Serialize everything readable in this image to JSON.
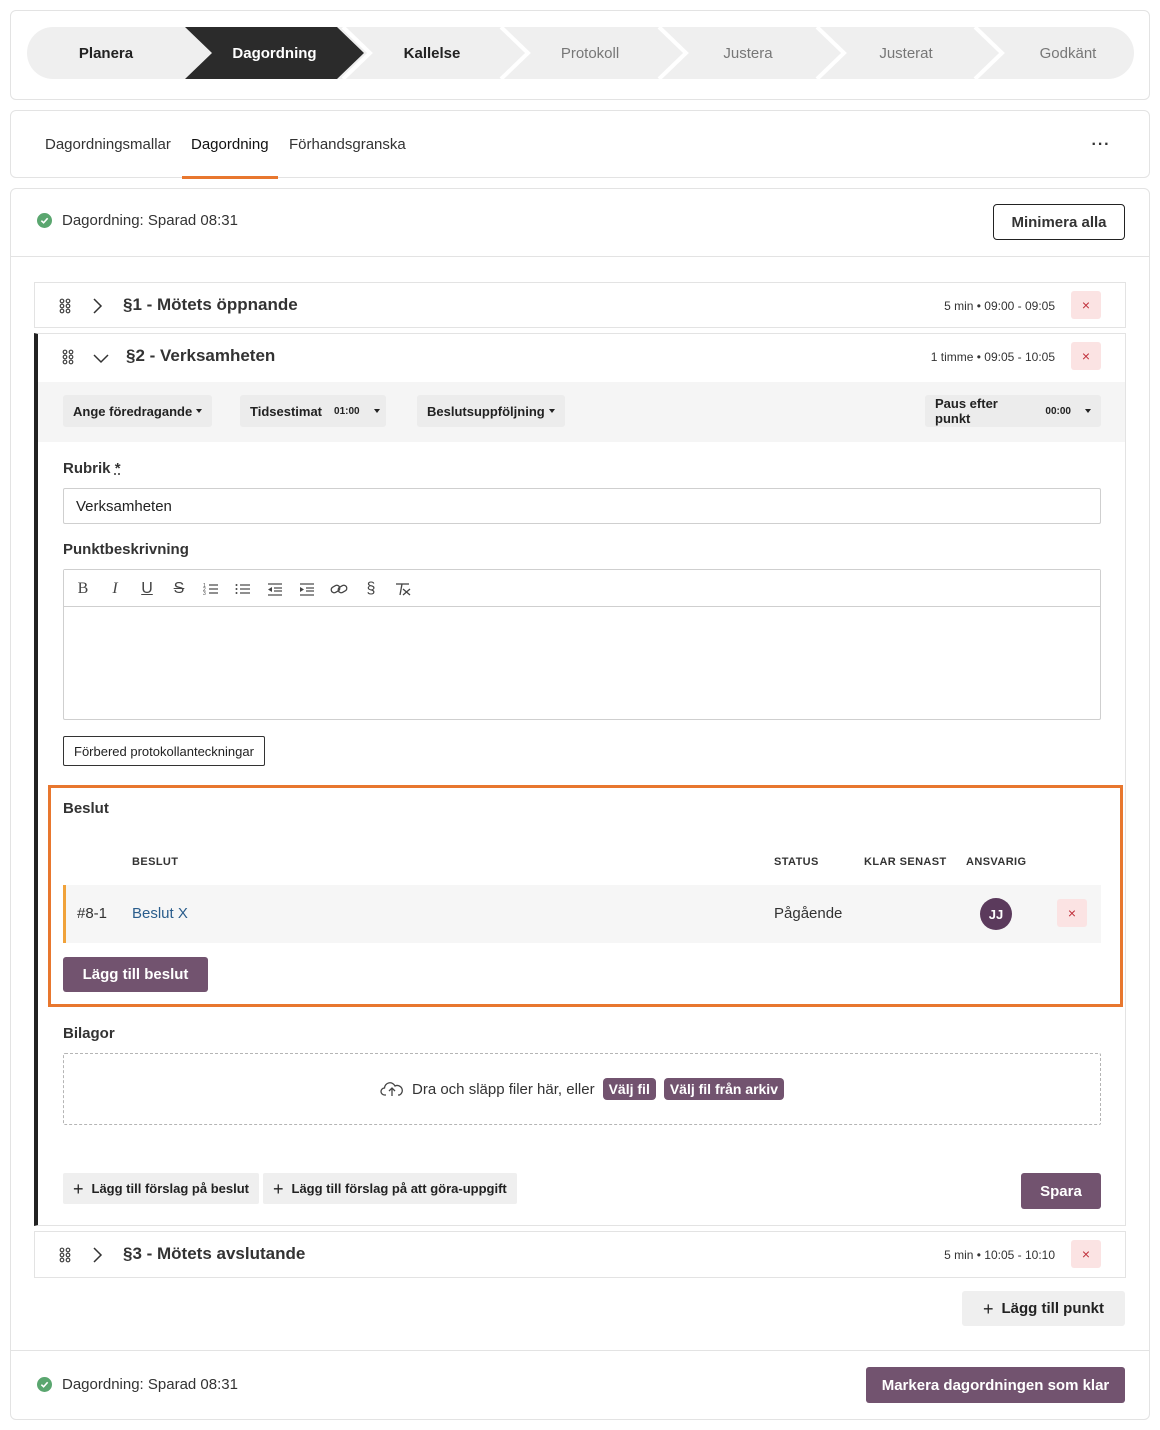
{
  "stepper": {
    "steps": [
      {
        "label": "Planera",
        "state": "done"
      },
      {
        "label": "Dagordning",
        "state": "active"
      },
      {
        "label": "Kallelse",
        "state": "done"
      },
      {
        "label": "Protokoll",
        "state": "future"
      },
      {
        "label": "Justera",
        "state": "future"
      },
      {
        "label": "Justerat",
        "state": "future"
      },
      {
        "label": "Godkänt",
        "state": "future"
      }
    ]
  },
  "tabs": {
    "items": [
      "Dagordningsmallar",
      "Dagordning",
      "Förhandsgranska"
    ],
    "active": "Dagordning",
    "more": "···"
  },
  "status": {
    "saved_text": "Dagordning: Sparad 08:31",
    "minimize_label": "Minimera alla"
  },
  "agenda": {
    "items": [
      {
        "title": "§1 - Mötets öppnande",
        "time": "5 min • 09:00 - 09:05",
        "expanded": false
      },
      {
        "title": "§2 - Verksamheten",
        "time": "1 timme • 09:05 - 10:05",
        "expanded": true
      },
      {
        "title": "§3 - Mötets avslutande",
        "time": "5 min • 10:05 - 10:10",
        "expanded": false
      }
    ],
    "delete_glyph": "×",
    "add_point_label": "Lägg till punkt"
  },
  "detail": {
    "presenter_label": "Ange föredragande",
    "estimate_label": "Tidsestimat",
    "estimate_value": "01:00",
    "followup_label": "Beslutsuppföljning",
    "pause_label": "Paus efter punkt",
    "pause_value": "00:00",
    "rubrik_label": "Rubrik",
    "rubrik_required": "*",
    "rubrik_value": "Verksamheten",
    "description_label": "Punktbeskrivning",
    "prepare_notes_label": "Förbered protokollanteckningar"
  },
  "decisions": {
    "heading": "Beslut",
    "columns": [
      "BESLUT",
      "STATUS",
      "KLAR SENAST",
      "ANSVARIG"
    ],
    "rows": [
      {
        "id": "#8-1",
        "title": "Beslut X",
        "status": "Pågående",
        "due": "",
        "owner_initials": "JJ"
      }
    ],
    "add_label": "Lägg till beslut"
  },
  "attachments": {
    "heading": "Bilagor",
    "drop_text": "Dra och släpp filer här, eller",
    "choose_file": "Välj fil",
    "choose_archive": "Välj fil från arkiv"
  },
  "actions": {
    "suggest_decision": "Lägg till förslag på beslut",
    "suggest_todo": "Lägg till förslag på att göra-uppgift",
    "save": "Spara"
  },
  "footer": {
    "saved_text": "Dagordning: Sparad 08:31",
    "mark_done_label": "Markera dagordningen som klar"
  },
  "colors": {
    "accent_orange": "#e8772e",
    "primary_purple": "#72536f",
    "active_step": "#2b2b2b",
    "success_green": "#5aa66f",
    "delete_red": "#c0303b"
  }
}
